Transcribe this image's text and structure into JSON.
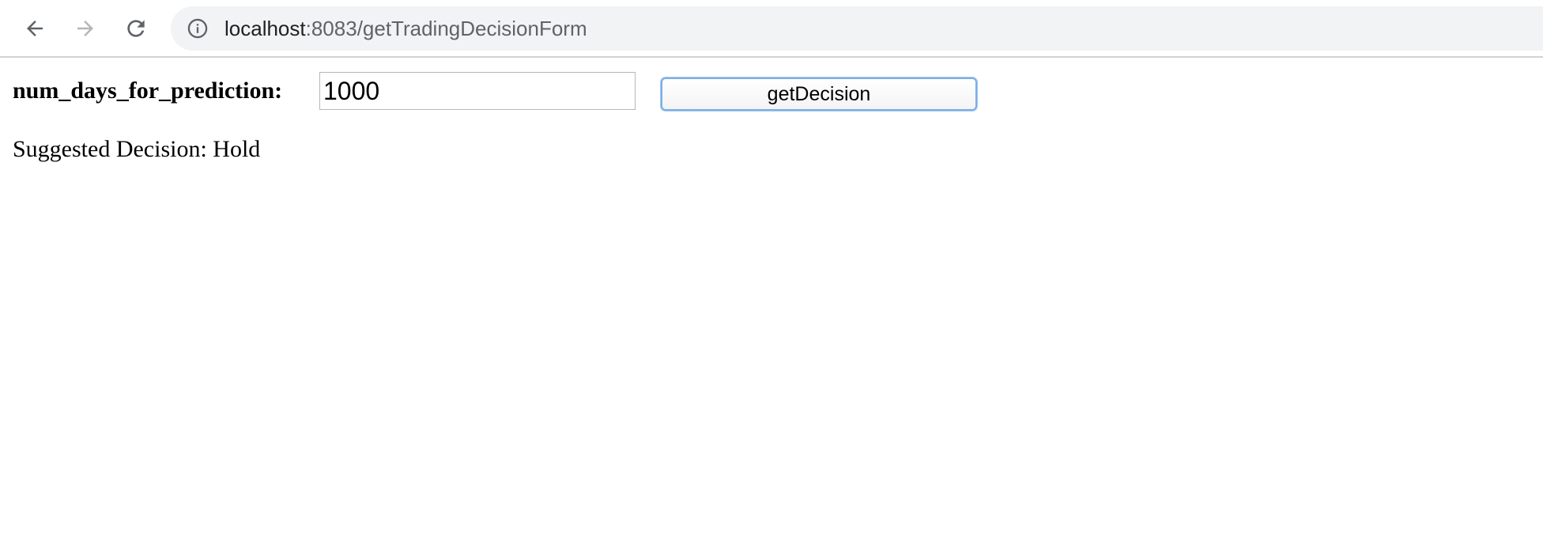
{
  "browser": {
    "url_host": "localhost",
    "url_path": ":8083/getTradingDecisionForm",
    "icons": {
      "back": "arrow-left-icon",
      "forward": "arrow-right-icon",
      "reload": "reload-icon",
      "info": "info-icon"
    }
  },
  "form": {
    "label": "num_days_for_prediction:",
    "input_value": "1000",
    "submit_label": "getDecision"
  },
  "result": {
    "text": "Suggested Decision: Hold"
  },
  "colors": {
    "omnibox_bg": "#f1f3f4",
    "button_focus_border": "#7aaee6",
    "url_path": "#5f6368"
  }
}
